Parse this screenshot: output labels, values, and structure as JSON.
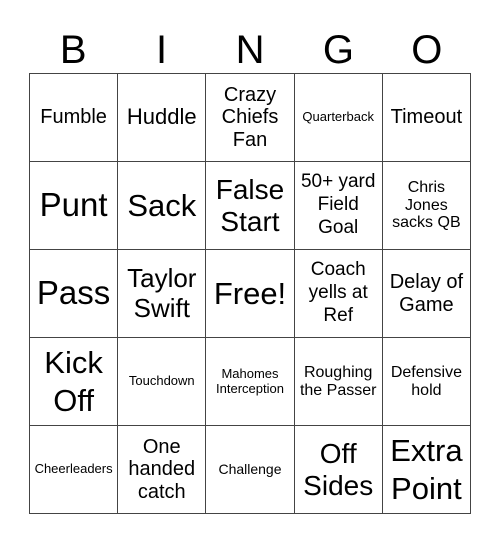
{
  "header": [
    "B",
    "I",
    "N",
    "G",
    "O"
  ],
  "cells": [
    [
      "Fumble",
      "Huddle",
      "Crazy Chiefs Fan",
      "Quarterback",
      "Timeout"
    ],
    [
      "Punt",
      "Sack",
      "False Start",
      "50+ yard Field Goal",
      "Chris Jones sacks QB"
    ],
    [
      "Pass",
      "Taylor Swift",
      "Free!",
      "Coach yells at Ref",
      "Delay of Game"
    ],
    [
      "Kick Off",
      "Touchdown",
      "Mahomes Interception",
      "Roughing the Passer",
      "Defensive hold"
    ],
    [
      "Cheerleaders",
      "One handed catch",
      "Challenge",
      "Off Sides",
      "Extra Point"
    ]
  ]
}
